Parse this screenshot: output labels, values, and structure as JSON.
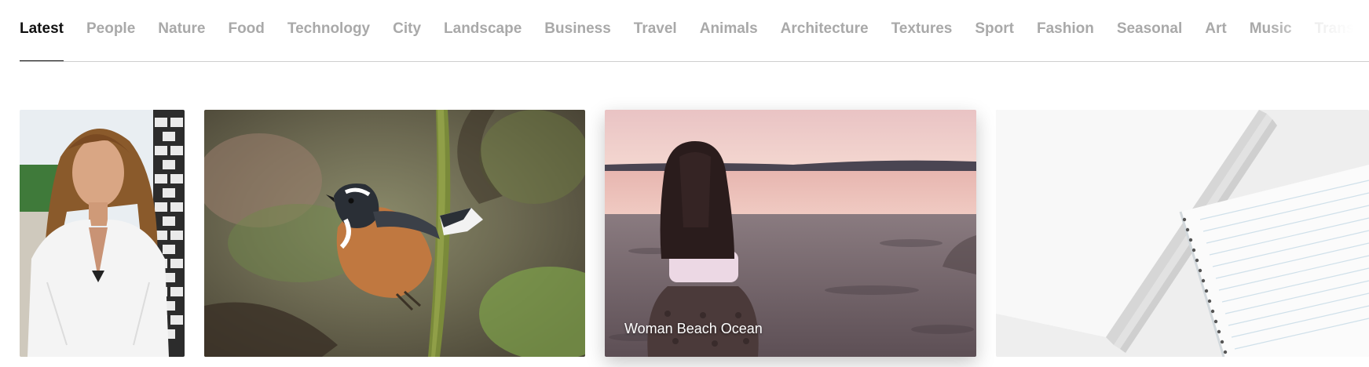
{
  "categories": {
    "tabs": [
      "Latest",
      "People",
      "Nature",
      "Food",
      "Technology",
      "City",
      "Landscape",
      "Business",
      "Travel",
      "Animals",
      "Architecture",
      "Textures",
      "Sport",
      "Fashion",
      "Seasonal",
      "Art",
      "Music",
      "Transport"
    ],
    "active": "Latest"
  },
  "gallery": {
    "photos": [
      {
        "subject": "woman-white-shirt"
      },
      {
        "subject": "bird-on-branch"
      },
      {
        "subject": "woman-on-beach",
        "caption": "Woman Beach Ocean"
      },
      {
        "subject": "paper-and-notebook"
      }
    ]
  },
  "colors": {
    "active_tab": "#111111",
    "inactive_tab": "#a9a9a9",
    "divider": "#cfcfcf"
  }
}
